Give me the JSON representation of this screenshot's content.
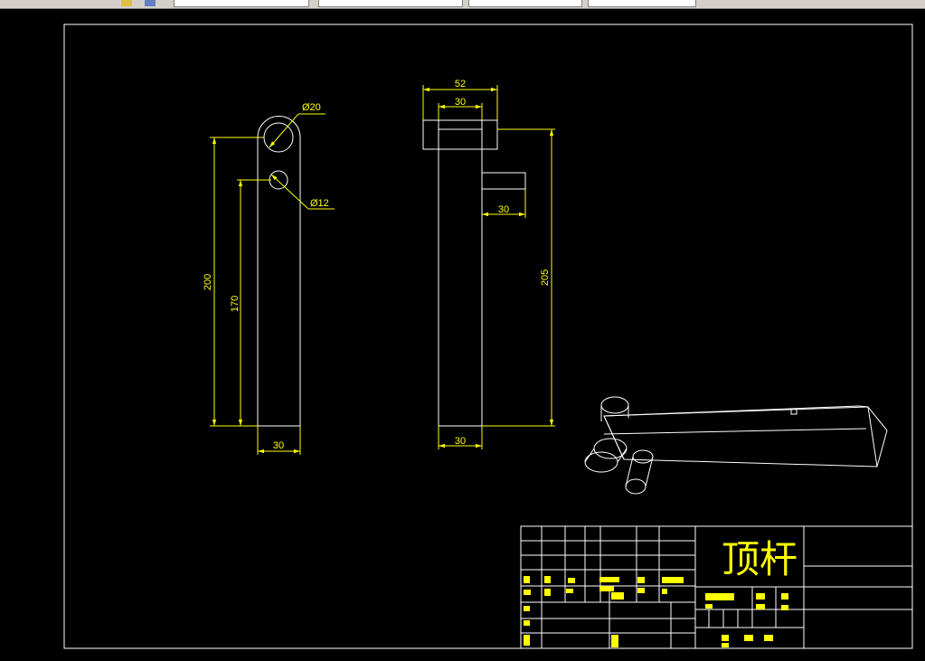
{
  "title_block": {
    "title": "顶杆"
  },
  "dimensions": {
    "d20": "Ø20",
    "d12": "Ø12",
    "h200": "200",
    "h170": "170",
    "w30_front": "30",
    "w52": "52",
    "w30_top": "30",
    "w30_pin": "30",
    "h205": "205",
    "w30_side": "30"
  },
  "colors": {
    "outline": "#ffffff",
    "dimension": "#ffff00",
    "background": "#000000",
    "toolbar": "#d4d0c8"
  }
}
